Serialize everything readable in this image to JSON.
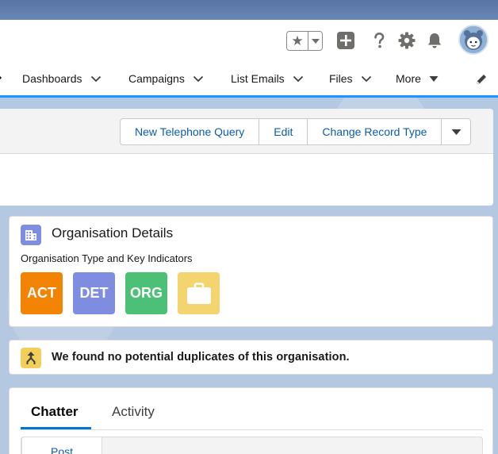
{
  "global_header": {
    "icons": [
      "star-icon",
      "caret-down-icon",
      "plus-icon",
      "help-icon",
      "gear-icon",
      "bell-icon",
      "avatar"
    ]
  },
  "nav": {
    "items": [
      {
        "label": "Dashboards"
      },
      {
        "label": "Campaigns"
      },
      {
        "label": "List Emails"
      },
      {
        "label": "Files"
      },
      {
        "label": "More"
      }
    ]
  },
  "record_actions": {
    "buttons": [
      "New Telephone Query",
      "Edit",
      "Change Record Type"
    ]
  },
  "org_details": {
    "title": "Organisation Details",
    "subtitle": "Organisation Type and Key Indicators",
    "badges": [
      {
        "label": "ACT",
        "color": "#f38303"
      },
      {
        "label": "DET",
        "color": "#7f8de1"
      },
      {
        "label": "ORG",
        "color": "#4bc076"
      },
      {
        "label": "",
        "color": "#f4d46e",
        "icon": "briefcase-icon"
      }
    ]
  },
  "duplicates": {
    "message": "We found no potential duplicates of this organisation."
  },
  "activity": {
    "tabs": [
      "Chatter",
      "Activity"
    ],
    "publisher_tab": "Post"
  },
  "colors": {
    "brand_blue": "#0176d3",
    "nav_underline": "#1b96ff",
    "link": "#0b5cab"
  }
}
